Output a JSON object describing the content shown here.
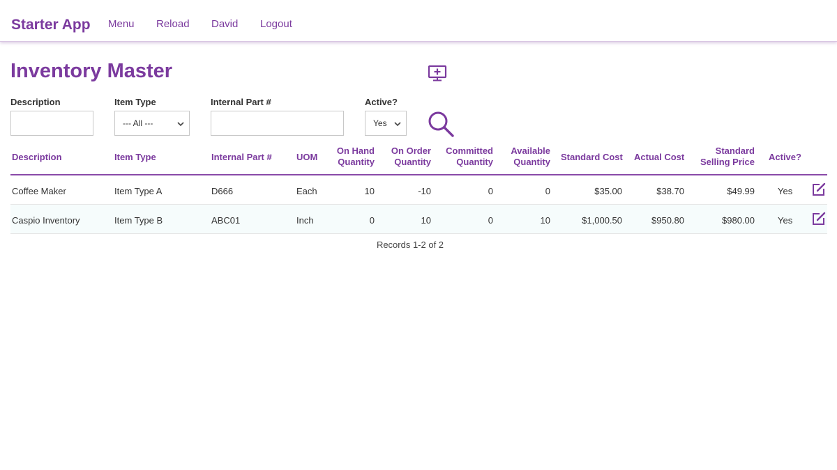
{
  "app": {
    "brand": "Starter App"
  },
  "nav": {
    "menu": "Menu",
    "reload": "Reload",
    "user": "David",
    "logout": "Logout"
  },
  "page": {
    "title": "Inventory Master"
  },
  "filters": {
    "description_label": "Description",
    "description_value": "",
    "item_type_label": "Item Type",
    "item_type_selected": "--- All ---",
    "internal_part_label": "Internal Part #",
    "internal_part_value": "",
    "active_label": "Active?",
    "active_selected": "Yes"
  },
  "table": {
    "headers": {
      "description": "Description",
      "item_type": "Item Type",
      "internal_part": "Internal Part #",
      "uom": "UOM",
      "on_hand_1": "On Hand",
      "on_hand_2": "Quantity",
      "on_order_1": "On Order",
      "on_order_2": "Quantity",
      "committed_1": "Committed",
      "committed_2": "Quantity",
      "available_1": "Available",
      "available_2": "Quantity",
      "standard_cost": "Standard Cost",
      "actual_cost": "Actual Cost",
      "selling_1": "Standard",
      "selling_2": "Selling Price",
      "active": "Active?"
    },
    "rows": [
      {
        "description": "Coffee Maker",
        "item_type": "Item Type A",
        "internal_part": "D666",
        "uom": "Each",
        "on_hand": "10",
        "on_order": "-10",
        "committed": "0",
        "available": "0",
        "standard_cost": "$35.00",
        "actual_cost": "$38.70",
        "selling_price": "$49.99",
        "active": "Yes"
      },
      {
        "description": "Caspio Inventory",
        "item_type": "Item Type B",
        "internal_part": "ABC01",
        "uom": "Inch",
        "on_hand": "0",
        "on_order": "10",
        "committed": "0",
        "available": "10",
        "standard_cost": "$1,000.50",
        "actual_cost": "$950.80",
        "selling_price": "$980.00",
        "active": "Yes"
      }
    ]
  },
  "footer": {
    "records": "Records 1-2 of 2"
  },
  "icons": {
    "add": "monitor-plus-icon",
    "search": "search-icon",
    "edit": "edit-icon",
    "chevron": "chevron-down-icon"
  },
  "colors": {
    "accent": "#7b3a9e",
    "row_alt": "#f6fcfc",
    "divider": "#8a4aa8"
  }
}
